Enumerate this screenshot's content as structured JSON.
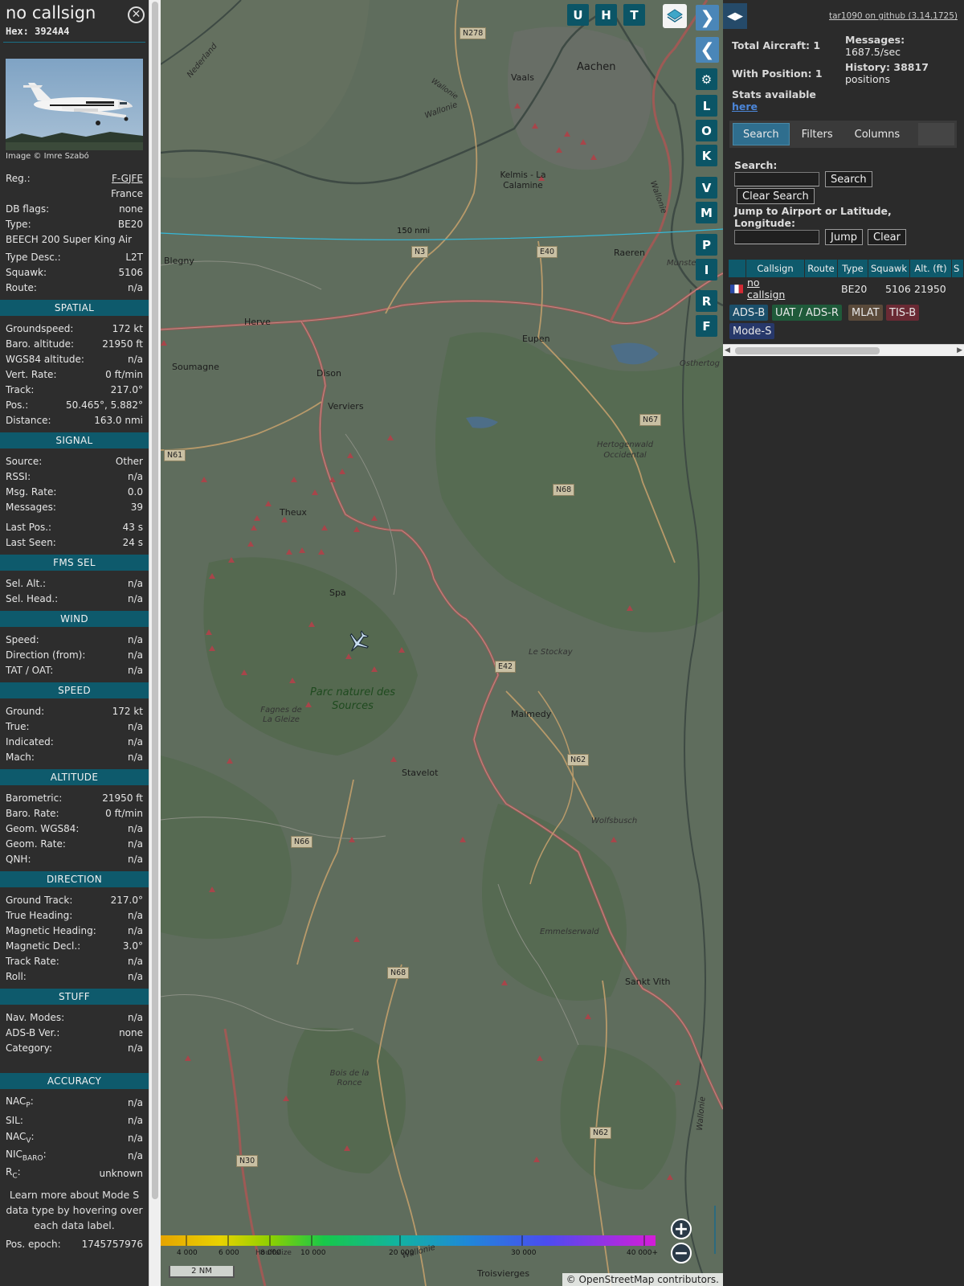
{
  "info": {
    "callsign": "no callsign",
    "hex": "Hex: 3924A4",
    "photo_credit": "Image © Imre Szabó",
    "top": [
      {
        "label": "Reg.:",
        "value": "F-GJFE"
      },
      {
        "label": "",
        "value": "France"
      },
      {
        "label": "DB flags:",
        "value": "none"
      },
      {
        "label": "Type:",
        "value": "BE20"
      },
      {
        "label": "BEECH 200 Super King Air",
        "value": ""
      },
      {
        "label": "Type Desc.:",
        "value": "L2T"
      },
      {
        "label": "Squawk:",
        "value": "5106"
      },
      {
        "label": "Route:",
        "value": "n/a"
      }
    ],
    "sections": {
      "spatial": {
        "title": "SPATIAL",
        "rows": [
          {
            "label": "Groundspeed:",
            "value": "172 kt"
          },
          {
            "label": "Baro. altitude:",
            "value": "21950 ft"
          },
          {
            "label": "WGS84 altitude:",
            "value": "n/a"
          },
          {
            "label": "Vert. Rate:",
            "value": "0 ft/min"
          },
          {
            "label": "Track:",
            "value": "217.0°"
          },
          {
            "label": "Pos.:",
            "value": "50.465°, 5.882°"
          },
          {
            "label": "Distance:",
            "value": "163.0 nmi"
          }
        ]
      },
      "signal": {
        "title": "SIGNAL",
        "rows": [
          {
            "label": "Source:",
            "value": "Other"
          },
          {
            "label": "RSSI:",
            "value": "n/a"
          },
          {
            "label": "Msg. Rate:",
            "value": "0.0"
          },
          {
            "label": "Messages:",
            "value": "39"
          },
          {
            "label": "Last Pos.:",
            "value": "43 s"
          },
          {
            "label": "Last Seen:",
            "value": "24 s"
          }
        ]
      },
      "fms": {
        "title": "FMS SEL",
        "rows": [
          {
            "label": "Sel. Alt.:",
            "value": "n/a"
          },
          {
            "label": "Sel. Head.:",
            "value": "n/a"
          }
        ]
      },
      "wind": {
        "title": "WIND",
        "rows": [
          {
            "label": "Speed:",
            "value": "n/a"
          },
          {
            "label": "Direction (from):",
            "value": "n/a"
          },
          {
            "label": "TAT / OAT:",
            "value": "n/a"
          }
        ]
      },
      "speed": {
        "title": "SPEED",
        "rows": [
          {
            "label": "Ground:",
            "value": "172 kt"
          },
          {
            "label": "True:",
            "value": "n/a"
          },
          {
            "label": "Indicated:",
            "value": "n/a"
          },
          {
            "label": "Mach:",
            "value": "n/a"
          }
        ]
      },
      "altitude": {
        "title": "ALTITUDE",
        "rows": [
          {
            "label": "Barometric:",
            "value": "21950 ft"
          },
          {
            "label": "Baro. Rate:",
            "value": "0 ft/min"
          },
          {
            "label": "Geom. WGS84:",
            "value": "n/a"
          },
          {
            "label": "Geom. Rate:",
            "value": "n/a"
          },
          {
            "label": "QNH:",
            "value": "n/a"
          }
        ]
      },
      "direction": {
        "title": "DIRECTION",
        "rows": [
          {
            "label": "Ground Track:",
            "value": "217.0°"
          },
          {
            "label": "True Heading:",
            "value": "n/a"
          },
          {
            "label": "Magnetic Heading:",
            "value": "n/a"
          },
          {
            "label": "Magnetic Decl.:",
            "value": "3.0°"
          },
          {
            "label": "Track Rate:",
            "value": "n/a"
          },
          {
            "label": "Roll:",
            "value": "n/a"
          }
        ]
      },
      "stuff": {
        "title": "STUFF",
        "rows": [
          {
            "label": "Nav. Modes:",
            "value": "n/a"
          },
          {
            "label": "ADS-B Ver.:",
            "value": "none"
          },
          {
            "label": "Category:",
            "value": "n/a"
          }
        ]
      },
      "accuracy": {
        "title": "ACCURACY",
        "rows": [
          {
            "label": "NAC",
            "sub": "P",
            "value": "n/a"
          },
          {
            "label": "SIL:",
            "sub": "",
            "value": "n/a"
          },
          {
            "label": "NAC",
            "sub": "V",
            "value": "n/a"
          },
          {
            "label": "NIC",
            "sub": "BARO",
            "value": "n/a"
          },
          {
            "label": "R",
            "sub": "C",
            "value": "unknown"
          }
        ]
      }
    },
    "learn_more": "Learn more about Mode S data type by hovering over each data label.",
    "pos_epoch_label": "Pos. epoch:",
    "pos_epoch_value": "1745757976"
  },
  "map": {
    "tool_buttons": {
      "u": "U",
      "h": "H",
      "t": "T",
      "l": "L",
      "o": "O",
      "k": "K",
      "v": "V",
      "m": "M",
      "p": "P",
      "i": "I",
      "r": "R",
      "f": "F"
    },
    "range_ring_label": "150 nmi",
    "places": {
      "aachen": "Aachen",
      "vaals": "Vaals",
      "kelmis": "Kelmis - La Calamine",
      "raeren": "Raeren",
      "blegny": "Blegny",
      "herve": "Herve",
      "eupen": "Eupen",
      "soumagne": "Soumagne",
      "dison": "Dison",
      "verviers": "Verviers",
      "theux": "Theux",
      "spa": "Spa",
      "malmedy": "Malmedy",
      "stavelot": "Stavelot",
      "sankt_vith": "Sankt Vith",
      "trois_vierges": "Troisvierges",
      "monschau": "Munster",
      "osthertog": "Osthertog",
      "hertogenwald": "Hertogenwald Occidental",
      "le_stockay": "Le Stockay",
      "wolfsbusch": "Wolfsbusch",
      "emmelserwald": "Emmelserwald",
      "fagnes": "Fagnes de La Gleize",
      "bois_ronce": "Bois de la Ronce",
      "park": "Parc naturel des Sources",
      "nederland": "Nederland",
      "wallonie1": "Wallonie",
      "wallonie2": "Wallonie",
      "wallonie3": "Wallonie",
      "wallonie4": "Wallonie",
      "wallonie5": "Wallonie"
    },
    "roads": {
      "n278": "N278",
      "n3": "N3",
      "e40": "E40",
      "n67": "N67",
      "n61": "N61",
      "n68a": "N68",
      "e42": "E42",
      "n62a": "N62",
      "n66": "N66",
      "n68b": "N68",
      "n62b": "N62",
      "n30": "N30"
    },
    "colorbar_ticks": [
      "4 000",
      "6 000",
      "8 000",
      "10 000",
      "20 000",
      "30 000",
      "40 000+"
    ],
    "colorbar_overlap": "Houffalize",
    "scale": "2 NM",
    "attribution": "© OpenStreetMap contributors."
  },
  "panel": {
    "github": "tar1090 on github (3.14.1725)",
    "total_aircraft": "Total Aircraft: 1",
    "with_position": "With Position: 1",
    "messages_label": "Messages:",
    "messages_value": "1687.5/sec",
    "history_label": "History: 38817",
    "history_value": "positions",
    "stats_label": "Stats available",
    "stats_link": "here",
    "tabs": [
      "Search",
      "Filters",
      "Columns"
    ],
    "search_label": "Search:",
    "search_button": "Search",
    "clear_search": "Clear Search",
    "jump_label": "Jump to Airport or Latitude, Longitude:",
    "jump_button": "Jump",
    "clear_button": "Clear",
    "table": {
      "headers": [
        "Callsign",
        "Route",
        "Type",
        "Squawk",
        "Alt. (ft)",
        "S"
      ],
      "row": {
        "callsign": "no callsign",
        "route": "",
        "type": "BE20",
        "squawk": "5106",
        "alt": "21950"
      }
    },
    "badges": [
      "ADS-B",
      "UAT / ADS-R",
      "MLAT",
      "TIS-B",
      "Mode-S"
    ],
    "badge_colors": [
      "#1b4f6a",
      "#1f5a3a",
      "#5a4a3a",
      "#6a2a34",
      "#27386a"
    ]
  }
}
